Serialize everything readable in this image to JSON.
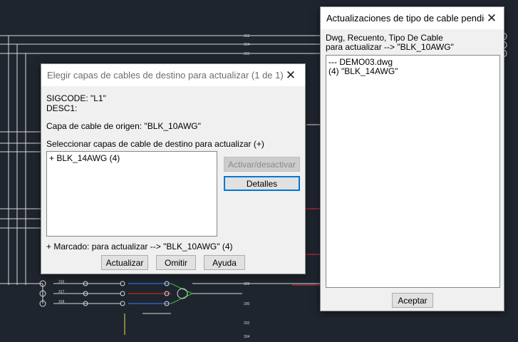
{
  "colors": {
    "cad_background": "#1f252e",
    "wire_white": "#d8d8d8",
    "wire_blue": "#3a7bff",
    "wire_green": "#3fc23f",
    "wire_red": "#e03030",
    "label_yellow": "#e8e04a",
    "label_cyan": "#27a3ff"
  },
  "cad": {
    "wire_labels": [
      "313",
      "314",
      "315",
      "316",
      "317",
      "318",
      "320",
      "330",
      "332",
      "334"
    ]
  },
  "dialog1": {
    "title": "Elegir capas de cables de destino para actualizar  (1 de 1)",
    "sigcode": "SIGCODE: \"L1\"",
    "desc1": "DESC1:",
    "source_layer": "Capa de cable de origen:    \"BLK_10AWG\"",
    "select_label": "Seleccionar capas de cable de destino para actualizar (+)",
    "list_items": [
      "+ BLK_14AWG  (4)"
    ],
    "toggle_button": "Activar/desactivar",
    "details_button": "Detalles",
    "footer": "+  Marcado: para actualizar --> \"BLK_10AWG\"  (4)",
    "update_button": "Actualizar",
    "skip_button": "Omitir",
    "help_button": "Ayuda"
  },
  "dialog2": {
    "title": "Actualizaciones de tipo de cable pendie...",
    "header_line1": "Dwg, Recuento, Tipo De Cable",
    "header_line2": "para actualizar --> \"BLK_10AWG\"",
    "list_items": [
      "--- DEMO03.dwg",
      "(4)  \"BLK_14AWG\""
    ],
    "accept_button": "Aceptar"
  }
}
